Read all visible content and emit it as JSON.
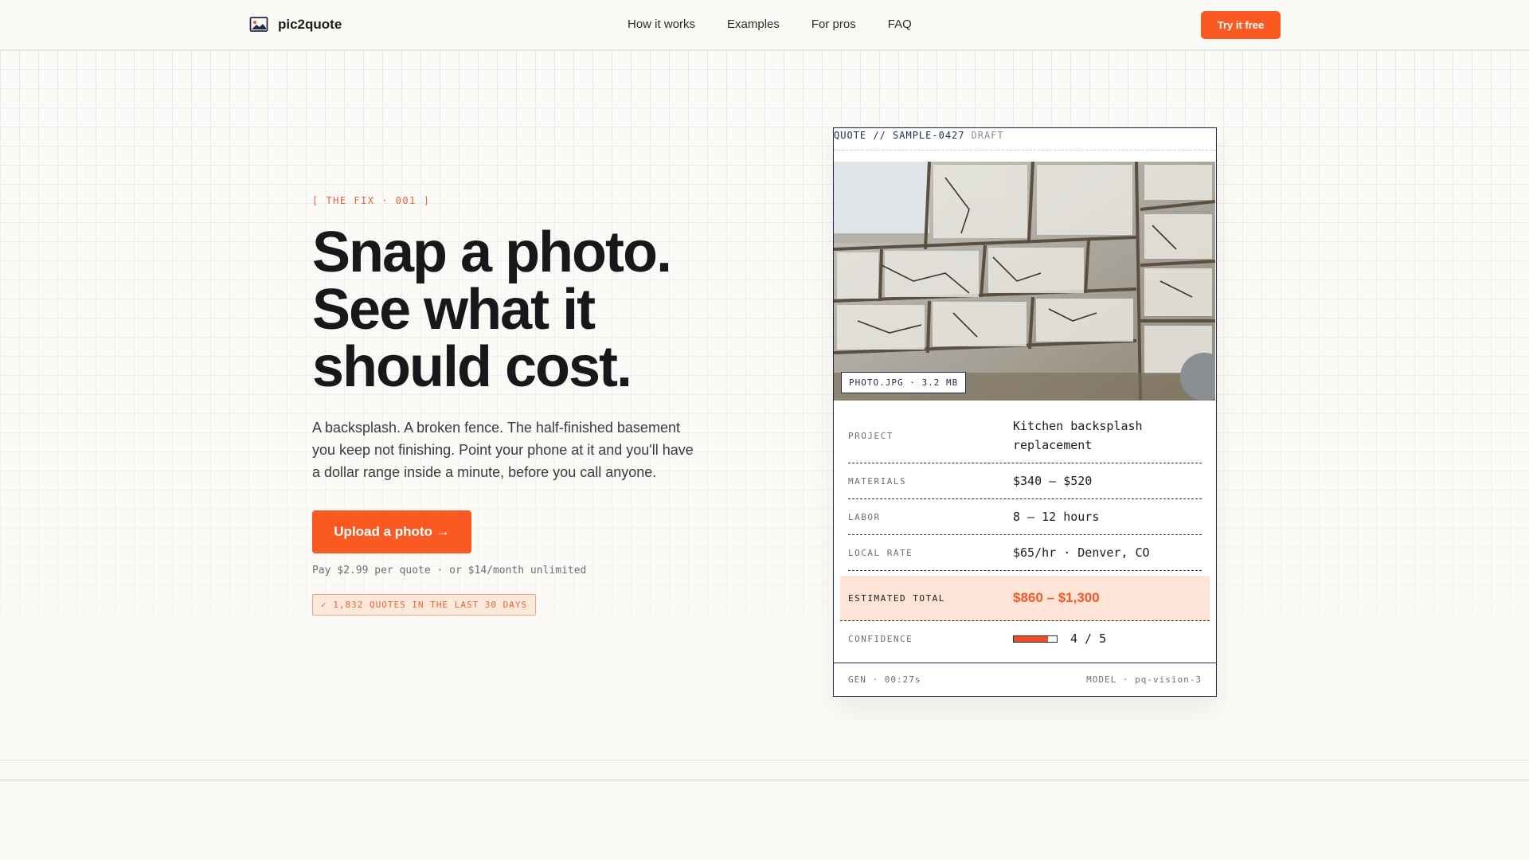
{
  "header": {
    "brand": "pic2quote",
    "logo_icon": "image-icon",
    "nav": [
      "How it works",
      "Examples",
      "For pros",
      "FAQ"
    ],
    "cta": "Try it free"
  },
  "hero": {
    "kicker": "[ THE FIX · 001 ]",
    "headline": [
      "Snap a photo.",
      "See what it",
      "should cost."
    ],
    "subcopy": "A backsplash. A broken fence. The half-finished basement you keep not finishing. Point your phone at it and you'll have a dollar range inside a minute, before you call anyone.",
    "upload_label": "Upload a photo →",
    "pricing": "Pay $2.99 per quote · or $14/month unlimited",
    "badge": "✓ 1,832 QUOTES IN THE LAST 30 DAYS"
  },
  "quote": {
    "id": "QUOTE // SAMPLE-0427",
    "status": "DRAFT",
    "photo_tag": "PHOTO.JPG · 3.2 MB",
    "rows": [
      {
        "label": "PROJECT",
        "value": "Kitchen backsplash replacement"
      },
      {
        "label": "MATERIALS",
        "value": "$340 – $520"
      },
      {
        "label": "LABOR",
        "value": "8 – 12 hours"
      },
      {
        "label": "LOCAL RATE",
        "value": "$65/hr · Denver, CO"
      }
    ],
    "total": {
      "label": "ESTIMATED TOTAL",
      "value": "$860 – $1,300"
    },
    "confidence": {
      "label": "CONFIDENCE",
      "value": "4 / 5",
      "fraction": 0.8
    },
    "footer_left": "GEN · 00:27s",
    "footer_right": "MODEL · pq-vision-3"
  },
  "colors": {
    "accent": "#fa5a22",
    "navy": "#1f2b4a",
    "highlight": "#fde4d6"
  }
}
